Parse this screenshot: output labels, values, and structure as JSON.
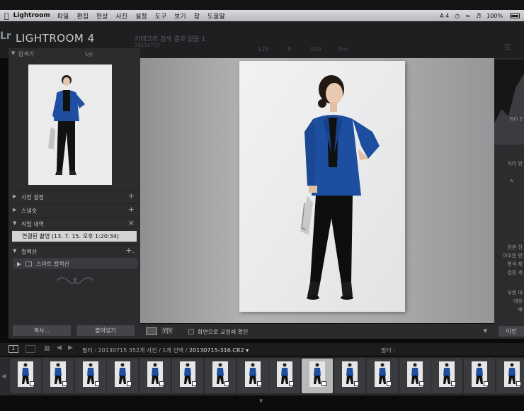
{
  "menubar": {
    "apple": "",
    "app_name": "Lightroom",
    "items": [
      "파일",
      "편집",
      "현상",
      "사진",
      "설정",
      "도구",
      "보기",
      "창",
      "도움말"
    ],
    "status": {
      "input": "A 4",
      "battery": "100%"
    }
  },
  "identity": {
    "badge": "Lr",
    "product": "LIGHTROOM 4",
    "doc_title": "카테고리 검색 결과 없음 1",
    "doc_sub": "20130715",
    "exif": [
      "125",
      "8",
      "100",
      "5m"
    ],
    "right_letter": "도"
  },
  "left_panel": {
    "navigator": {
      "label": "탐색기",
      "zoom": "맞춤"
    },
    "sections": {
      "presets": {
        "label": "사전 설정",
        "action": "+"
      },
      "snapshots": {
        "label": "스냅숏",
        "action": "+"
      },
      "history": {
        "label": "작업 내역",
        "action": "×"
      },
      "collections": {
        "label": "컬렉션",
        "action": "+."
      }
    },
    "history_item": "연결된 촬영 (13. 7. 15. 오후 1:20:34)",
    "collection_item": "스마트 컬렉션",
    "buttons": {
      "copy": "복사...",
      "paste": "붙여넣기"
    }
  },
  "toolbar": {
    "view_mode": "Y|Y",
    "softproof_label": "화면으로 교정쇄 확인",
    "menu": "▼"
  },
  "right_panel": {
    "iso": "ISO 2",
    "panel_label": "처리 방",
    "labels": [
      "원본 전",
      "아우한 언",
      "통색 제",
      "검정 계",
      "부분 대",
      "대응",
      "배",
      "이전"
    ],
    "prev_button": "이전"
  },
  "filmstrip_header": {
    "page": "1",
    "source_prefix": "필터 : 20130715   352개 사진 / 1개 선택 /",
    "filename": "20130715-316.CR2 ▾",
    "filter_label": "필터 :"
  },
  "filmstrip": {
    "thumb_count": 17,
    "selected_index": 9
  },
  "colors": {
    "panel_bg": "#2b2c2e",
    "blazer_blue": "#1d4e9f",
    "photo_bg": "#eeeeef",
    "selected_cell": "#b8b9bb"
  },
  "icons": [
    "apple-icon",
    "wifi-icon",
    "volume-icon",
    "battery-icon",
    "folder-icon",
    "grid-icon",
    "prev-arrow-icon",
    "next-arrow-icon",
    "ornament-icon"
  ]
}
